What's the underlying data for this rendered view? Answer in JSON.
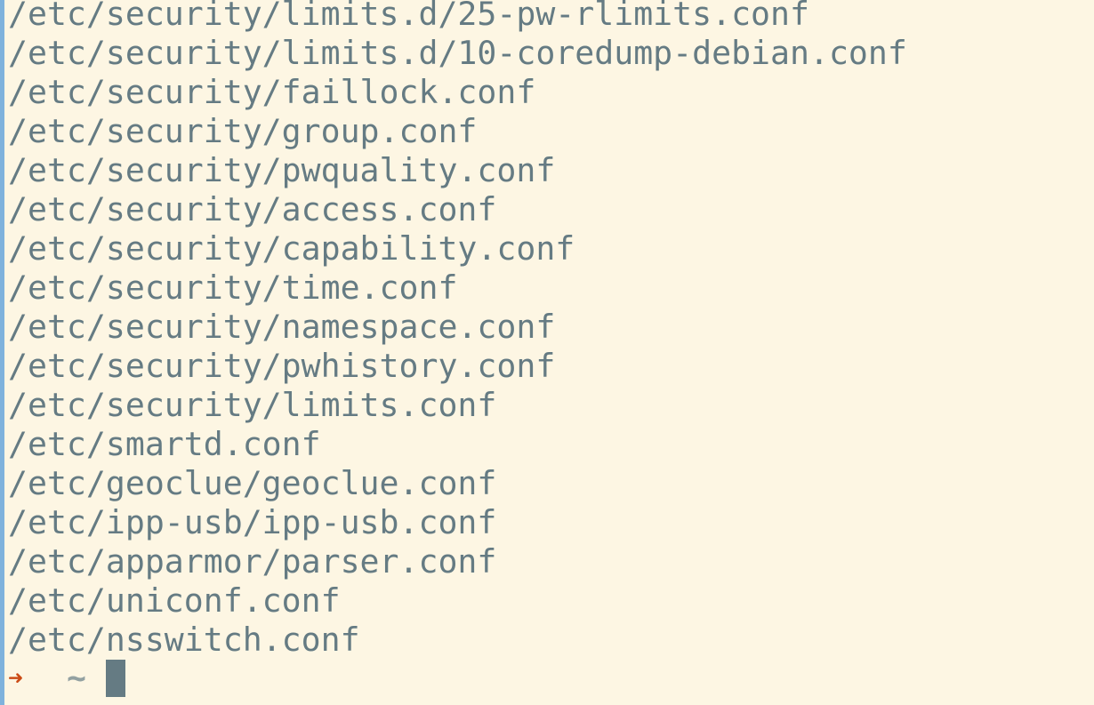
{
  "terminal": {
    "output_lines": [
      "/etc/security/limits.d/25-pw-rlimits.conf",
      "/etc/security/limits.d/10-coredump-debian.conf",
      "/etc/security/faillock.conf",
      "/etc/security/group.conf",
      "/etc/security/pwquality.conf",
      "/etc/security/access.conf",
      "/etc/security/capability.conf",
      "/etc/security/time.conf",
      "/etc/security/namespace.conf",
      "/etc/security/pwhistory.conf",
      "/etc/security/limits.conf",
      "/etc/smartd.conf",
      "/etc/geoclue/geoclue.conf",
      "/etc/ipp-usb/ipp-usb.conf",
      "/etc/apparmor/parser.conf",
      "/etc/uniconf.conf",
      "/etc/nsswitch.conf"
    ],
    "prompt": {
      "arrow": "➜",
      "directory": "~"
    }
  },
  "colors": {
    "background": "#fdf6e3",
    "text": "#657b83",
    "prompt_arrow": "#cb4b16",
    "prompt_directory": "#93a1a1",
    "cursor": "#657b83",
    "left_edge": "#7fb2dc"
  }
}
